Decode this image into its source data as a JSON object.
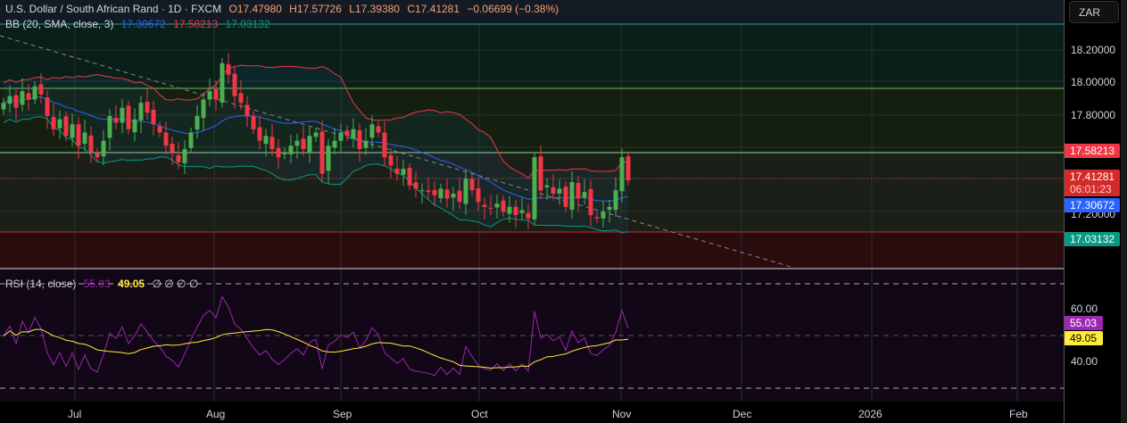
{
  "header": {
    "title": "U.S. Dollar / South African Rand · 1D · FXCM",
    "open": "O17.47980",
    "high": "H17.57726",
    "low": "L17.39380",
    "close": "C17.41281",
    "change": "−0.06699 (−0.38%)"
  },
  "bb_legend": {
    "label": "BB (20, SMA, close, 3)",
    "basis": "17.30672",
    "upper": "17.58213",
    "lower": "17.03132"
  },
  "rsi_legend": {
    "label": "RSI (14, close)",
    "rsi": "55.03",
    "ma": "49.05",
    "extra": "∅ ∅ ∅ ∅"
  },
  "currency_button": "ZAR",
  "price_ticks": [
    "18.20000",
    "18.00000",
    "17.80000",
    "17.20000"
  ],
  "price_tags": {
    "upper": "17.58213",
    "last": "17.41281",
    "countdown": "06:01:23",
    "basis": "17.30672",
    "lower": "17.03132"
  },
  "rsi_ticks": [
    "60.00",
    "40.00"
  ],
  "rsi_tags": {
    "rsi": "55.03",
    "ma": "49.05"
  },
  "time_labels": [
    "Jul",
    "Aug",
    "Sep",
    "Oct",
    "Nov",
    "Dec",
    "2026",
    "Feb"
  ],
  "colors": {
    "up": "#4caf50",
    "down": "#f23645",
    "basis": "#2962ff",
    "upper": "#f23645",
    "lower": "#089981",
    "rsi": "#9c27b0",
    "rsi_ma": "#ffeb3b"
  },
  "chart_data": {
    "type": "candlestick",
    "symbol": "USDZAR",
    "closes": [
      17.88,
      17.92,
      17.85,
      17.95,
      17.9,
      17.98,
      17.93,
      17.8,
      17.72,
      17.78,
      17.68,
      17.75,
      17.62,
      17.7,
      17.58,
      17.55,
      17.65,
      17.8,
      17.76,
      17.85,
      17.72,
      17.78,
      17.88,
      17.82,
      17.75,
      17.7,
      17.62,
      17.58,
      17.52,
      17.6,
      17.7,
      17.8,
      17.9,
      17.95,
      17.9,
      18.12,
      18.05,
      17.92,
      17.88,
      17.8,
      17.72,
      17.65,
      17.68,
      17.6,
      17.55,
      17.58,
      17.62,
      17.65,
      17.6,
      17.68,
      17.7,
      17.45,
      17.62,
      17.65,
      17.7,
      17.68,
      17.72,
      17.6,
      17.65,
      17.75,
      17.7,
      17.55,
      17.5,
      17.45,
      17.48,
      17.38,
      17.36,
      17.35,
      17.34,
      17.32,
      17.36,
      17.3,
      17.33,
      17.28,
      17.42,
      17.35,
      17.28,
      17.25,
      17.24,
      17.27,
      17.22,
      17.25,
      17.2,
      17.23,
      17.18,
      17.55,
      17.35,
      17.38,
      17.33,
      17.36,
      17.25,
      17.4,
      17.3,
      17.34,
      17.2,
      17.18,
      17.22,
      17.25,
      17.35,
      17.55,
      17.41
    ],
    "price_range": [
      16.9,
      18.35
    ],
    "rsi_range": [
      25,
      75
    ]
  }
}
